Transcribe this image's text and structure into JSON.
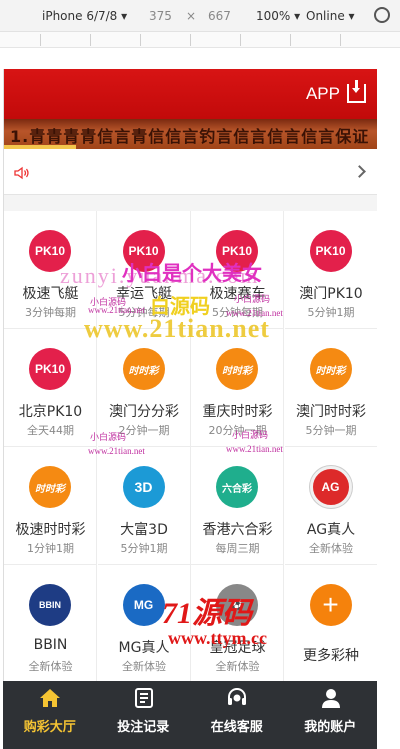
{
  "devtools": {
    "device": "iPhone 6/7/8 ▾",
    "width": "375",
    "times": "×",
    "height": "667",
    "zoom": "100% ▾",
    "network": "Online ▾"
  },
  "header": {
    "app_label": "APP"
  },
  "banner": {
    "text": "1.青青青青信言青信信言钓言信言信言信言保证"
  },
  "notice": {
    "speaker": "speaker-icon",
    "chevron": "chevron-right-icon"
  },
  "games": [
    {
      "name": "极速飞艇",
      "sub": "3分钟每期",
      "icon": "PK10",
      "icon_class": "ic-pk10"
    },
    {
      "name": "幸运飞艇",
      "sub": "5分钟每期",
      "icon": "PK10",
      "icon_class": "ic-pk10"
    },
    {
      "name": "极速赛车",
      "sub": "5分钟每期",
      "icon": "PK10",
      "icon_class": "ic-pk10"
    },
    {
      "name": "澳门PK10",
      "sub": "5分钟1期",
      "icon": "PK10",
      "icon_class": "ic-pk10"
    },
    {
      "name": "北京PK10",
      "sub": "全天44期",
      "icon": "PK10",
      "icon_class": "ic-pk10"
    },
    {
      "name": "澳门分分彩",
      "sub": "2分钟一期",
      "icon": "时时彩",
      "icon_class": "ic-ssc"
    },
    {
      "name": "重庆时时彩",
      "sub": "20分钟一期",
      "icon": "时时彩",
      "icon_class": "ic-ssc"
    },
    {
      "name": "澳门时时彩",
      "sub": "5分钟一期",
      "icon": "时时彩",
      "icon_class": "ic-ssc"
    },
    {
      "name": "极速时时彩",
      "sub": "1分钟1期",
      "icon": "时时彩",
      "icon_class": "ic-ssc"
    },
    {
      "name": "大富3D",
      "sub": "5分钟1期",
      "icon": "3D",
      "icon_class": "ic-3d"
    },
    {
      "name": "香港六合彩",
      "sub": "每周三期",
      "icon": "六合彩",
      "icon_class": "ic-hk"
    },
    {
      "name": "AG真人",
      "sub": "全新体验",
      "icon": "AG",
      "icon_class": "ic-ag"
    },
    {
      "name": "BBIN",
      "sub": "全新体验",
      "icon": "BBIN",
      "icon_class": "ic-bbin"
    },
    {
      "name": "MG真人",
      "sub": "全新体验",
      "icon": "MG",
      "icon_class": "ic-mg"
    },
    {
      "name": "皇冠足球",
      "sub": "全新体验",
      "icon": "⚽",
      "icon_class": "ic-ball"
    },
    {
      "name": "更多彩种",
      "sub": "",
      "icon": "+",
      "icon_class": "ic-more"
    }
  ],
  "watermarks": {
    "w1": "zunyi.yuanma.com",
    "w2": "小白是个大美女",
    "w3": "白源码",
    "w4": "www.21tian.net",
    "w5": "小白源码",
    "w6": "www.21tian.net",
    "w7": "小白源码",
    "w8": "www.21tian.net",
    "w9": "小白源码",
    "w10": "www.21tian.net",
    "w11": "小白源码",
    "w12": "www.21tian.net",
    "w13": "71源码",
    "w14": "www.ttym.cc"
  },
  "tabbar": [
    {
      "label": "购彩大厅",
      "icon": "home-icon",
      "active": true
    },
    {
      "label": "投注记录",
      "icon": "records-icon",
      "active": false
    },
    {
      "label": "在线客服",
      "icon": "headset-icon",
      "active": false
    },
    {
      "label": "我的账户",
      "icon": "user-icon",
      "active": false
    }
  ],
  "colors": {
    "header": "#d81414",
    "tabbar": "#2e3135",
    "active_tab": "#f5c433"
  }
}
